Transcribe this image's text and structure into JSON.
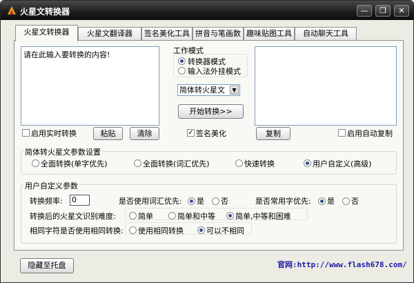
{
  "window": {
    "title": "火星文转换器",
    "controls": [
      "minimize-icon",
      "restore-icon",
      "close-icon"
    ]
  },
  "tabs": [
    "火星文转换器",
    "火星文翻译器",
    "签名美化工具",
    "拼音与笔画数",
    "趣味贴图工具",
    "自动聊天工具"
  ],
  "active_tab": 0,
  "editor": {
    "input_placeholder": "请在此输入要转换的内容!",
    "output_text": ""
  },
  "mode": {
    "label": "工作模式",
    "options": [
      "转换器模式",
      "输入法外挂模式"
    ],
    "selected": 0
  },
  "convert_select": {
    "value": "简体转火星文"
  },
  "buttons": {
    "start": "开始转换>>",
    "paste": "粘贴",
    "clear": "清除",
    "copy": "复制",
    "hide_tray": "隐藏至托盘"
  },
  "checkboxes": {
    "realtime": {
      "label": "启用实时转换",
      "checked": false
    },
    "signature": {
      "label": "签名美化",
      "checked": true
    },
    "autocopy": {
      "label": "启用自动复制",
      "checked": false
    }
  },
  "params": {
    "title": "简体转火星文参数设置",
    "options": [
      "全面转换(单字优先)",
      "全面转换(词汇优先)",
      "快速转换",
      "用户自定义(高级)"
    ],
    "selected": 3
  },
  "custom": {
    "title": "用户自定义参数",
    "freq_label": "转换频率:",
    "freq_value": "0",
    "phrase_label": "是否使用词汇优先:",
    "phrase_options": [
      "是",
      "否"
    ],
    "phrase_selected": 0,
    "common_label": "是否常用字优先:",
    "common_options": [
      "是",
      "否"
    ],
    "common_selected": 0,
    "difficulty_label": "转换后的火星文识别难度:",
    "difficulty_options": [
      "简单",
      "简单和中等",
      "简单,中等和困难"
    ],
    "difficulty_selected": 2,
    "same_label": "相同字符是否使用相同转换:",
    "same_options": [
      "使用相同转换",
      "可以不相同"
    ],
    "same_selected": 1
  },
  "footer": {
    "site_label": "官网:",
    "site_url": "http://www.flash678.com/"
  }
}
